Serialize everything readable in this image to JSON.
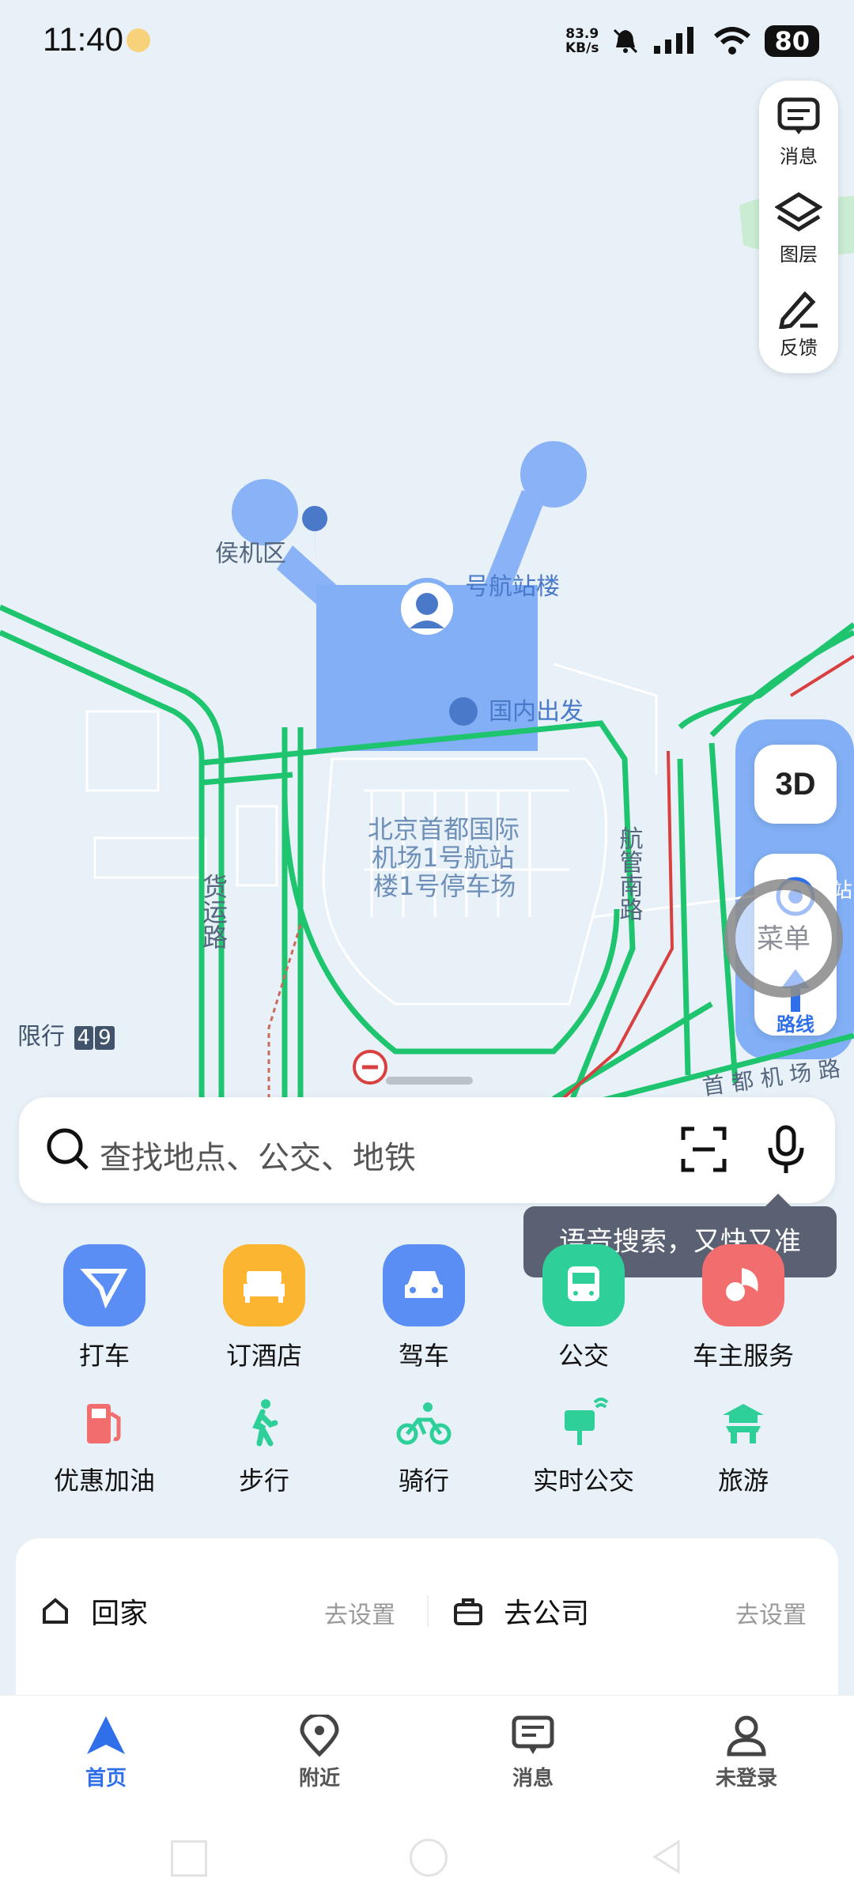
{
  "status_bar": {
    "time": "11:40",
    "net_speed_value": "83.9",
    "net_speed_unit": "KB/s",
    "battery": "80"
  },
  "map": {
    "labels": {
      "waiting_area": "侯机区",
      "terminal": "号航站楼",
      "domestic_departure": "国内出发",
      "parking_line1": "北京首都国际",
      "parking_line2": "机场1号航站",
      "parking_line3": "楼1号停车场",
      "road_cargo": "货运路",
      "road_south": "航管南路",
      "road_airport": "首 都 机 场 路",
      "station_fragment": "站"
    },
    "limit_label": "限行",
    "limit_numbers": [
      "4",
      "9"
    ]
  },
  "map_tools": {
    "message": "消息",
    "layers": "图层",
    "feedback": "反馈",
    "btn_3d": "3D",
    "menu": "菜单",
    "route": "路线"
  },
  "search": {
    "placeholder": "查找地点、公交、地铁",
    "voice_tooltip": "语音搜索，又快又准"
  },
  "shortcuts_primary": [
    {
      "label": "打车",
      "color": "#5b8ef5"
    },
    {
      "label": "订酒店",
      "color": "#fbb531"
    },
    {
      "label": "驾车",
      "color": "#5b8ef5"
    },
    {
      "label": "公交",
      "color": "#2fcf9a"
    },
    {
      "label": "车主服务",
      "color": "#f26d6d"
    }
  ],
  "shortcuts_secondary": [
    {
      "label": "优惠加油"
    },
    {
      "label": "步行"
    },
    {
      "label": "骑行"
    },
    {
      "label": "实时公交"
    },
    {
      "label": "旅游"
    }
  ],
  "favorites": {
    "home": "回家",
    "home_action": "去设置",
    "company": "去公司",
    "company_action": "去设置"
  },
  "bottom_nav": [
    {
      "label": "首页",
      "active": true
    },
    {
      "label": "附近",
      "active": false
    },
    {
      "label": "消息",
      "active": false
    },
    {
      "label": "未登录",
      "active": false
    }
  ],
  "colors": {
    "accent": "#2f6fea",
    "road_green": "#1fc46f",
    "terminal_blue": "#82aff5"
  }
}
